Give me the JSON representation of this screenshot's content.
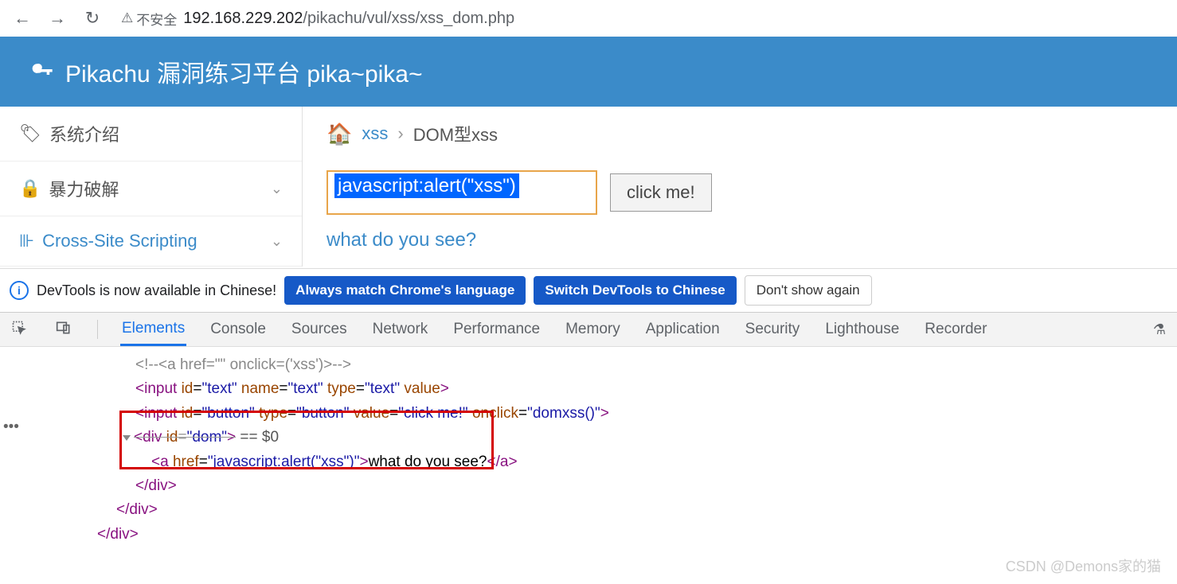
{
  "browser": {
    "security_label": "不安全",
    "url_host": "192.168.229.202",
    "url_path": "/pikachu/vul/xss/xss_dom.php"
  },
  "banner": {
    "title": "Pikachu 漏洞练习平台 pika~pika~"
  },
  "sidebar": {
    "items": [
      {
        "icon": "🏷",
        "label": "系统介绍",
        "chevron": false
      },
      {
        "icon": "🔒",
        "label": "暴力破解",
        "chevron": true
      },
      {
        "icon": "⊪",
        "label": "Cross-Site Scripting",
        "chevron": true,
        "active": true
      }
    ]
  },
  "breadcrumb": {
    "home_icon": "⌂",
    "item1": "xss",
    "sep": "›",
    "item2": "DOM型xss"
  },
  "form": {
    "input_value": "javascript:alert(\"xss\")",
    "button_label": "click me!",
    "result_link": "what do you see?"
  },
  "devtools_notif": {
    "text": "DevTools is now available in Chinese!",
    "btn1": "Always match Chrome's language",
    "btn2": "Switch DevTools to Chinese",
    "btn3": "Don't show again"
  },
  "devtools_tabs": [
    "Elements",
    "Console",
    "Sources",
    "Network",
    "Performance",
    "Memory",
    "Application",
    "Security",
    "Lighthouse",
    "Recorder"
  ],
  "source": {
    "line1_comment": "<!--<a href=\"\" onclick=('xss')>-->",
    "line2": "<input id=\"text\" name=\"text\" type=\"text\" value>",
    "line3": "<input id=\"button\" type=\"button\" value=\"click me!\" onclick=\"domxss()\">",
    "line4_open": "<div id=\"dom\">",
    "line4_marker": " == $0",
    "line5_pre": "<a href=\"",
    "line5_href": "javascript:alert(\"xss\")",
    "line5_mid": "\">",
    "line5_text": "what do you see?",
    "line5_close": "</a>",
    "line6": "</div>",
    "line7": "</div>",
    "line8": "</div>"
  },
  "watermark": "CSDN @Demons家的猫"
}
